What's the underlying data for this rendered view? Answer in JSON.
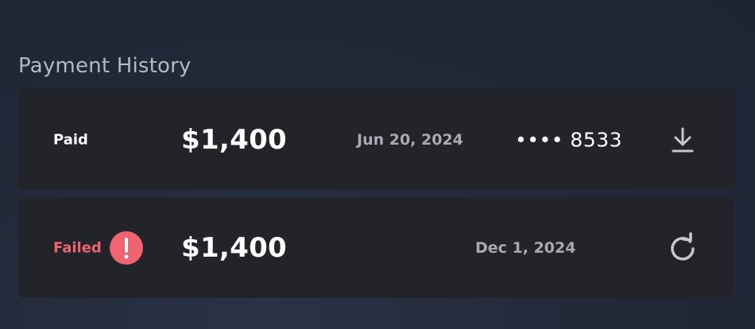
{
  "section": {
    "title": "Payment History"
  },
  "payments": [
    {
      "status": "Paid",
      "amount": "$1,400",
      "date": "Jun 20, 2024",
      "card_masked": "•••• 8533",
      "action_icon": "download-icon"
    },
    {
      "status": "Failed",
      "status_icon": "alert-icon",
      "amount": "$1,400",
      "date": "Dec 1, 2024",
      "action_icon": "retry-icon"
    }
  ],
  "colors": {
    "background": "#1f2636",
    "card": "#222429",
    "failed": "#ef6470",
    "muted_text": "#a8abb3",
    "title_text": "#b4b8c2"
  }
}
